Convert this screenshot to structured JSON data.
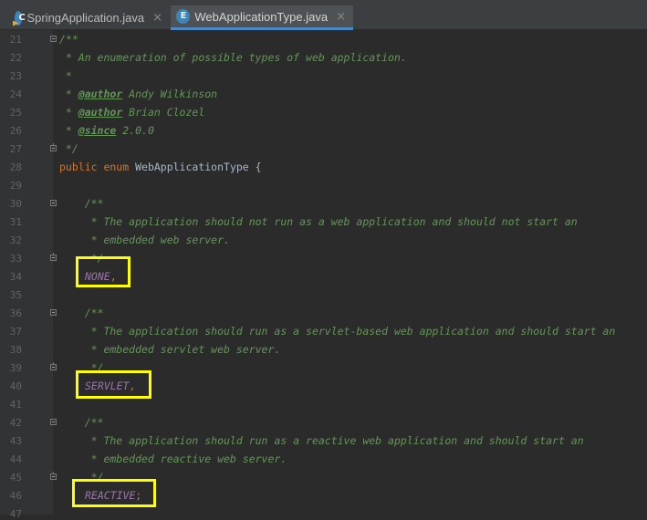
{
  "tabs": [
    {
      "label": "SpringApplication.java",
      "icon": "class-file-icon",
      "close": "×"
    },
    {
      "label": "WebApplicationType.java",
      "icon": "enum-file-icon",
      "close": "×"
    }
  ],
  "tab_icon_letters": {
    "class": "C",
    "enum": "E"
  },
  "line_numbers": [
    "21",
    "22",
    "23",
    "24",
    "25",
    "26",
    "27",
    "28",
    "29",
    "30",
    "31",
    "32",
    "33",
    "34",
    "35",
    "36",
    "37",
    "38",
    "39",
    "40",
    "41",
    "42",
    "43",
    "44",
    "45",
    "46",
    "47"
  ],
  "code": {
    "l21": "/**",
    "l22": " * An enumeration of possible types of web application.",
    "l23": " *",
    "l24_pre": " * ",
    "l24_tag": "@author",
    "l24_post": " Andy Wilkinson",
    "l25_pre": " * ",
    "l25_tag": "@author",
    "l25_post": " Brian Clozel",
    "l26_pre": " * ",
    "l26_tag": "@since",
    "l26_post": " 2.0.0",
    "l27": " */",
    "l28_kw": "public enum ",
    "l28_name": "WebApplicationType {",
    "l30": "    /**",
    "l31": "     * The application should not run as a web application and should not start an",
    "l32": "     * embedded web server.",
    "l33": "     */",
    "l34_const": "NONE",
    "l34_punct": ",",
    "l36": "    /**",
    "l37": "     * The application should run as a servlet-based web application and should start an",
    "l38": "     * embedded servlet web server.",
    "l39": "     */",
    "l40_const": "SERVLET",
    "l40_punct": ",",
    "l42": "    /**",
    "l43": "     * The application should run as a reactive web application and should start an",
    "l44": "     * embedded reactive web server.",
    "l45": "     */",
    "l46_const": "REACTIVE",
    "l46_punct": ";"
  },
  "colors": {
    "editor_bg": "#2b2b2b",
    "comment": "#629755",
    "keyword": "#cc7832",
    "constant": "#9876aa",
    "highlight_box": "#ffff00"
  }
}
